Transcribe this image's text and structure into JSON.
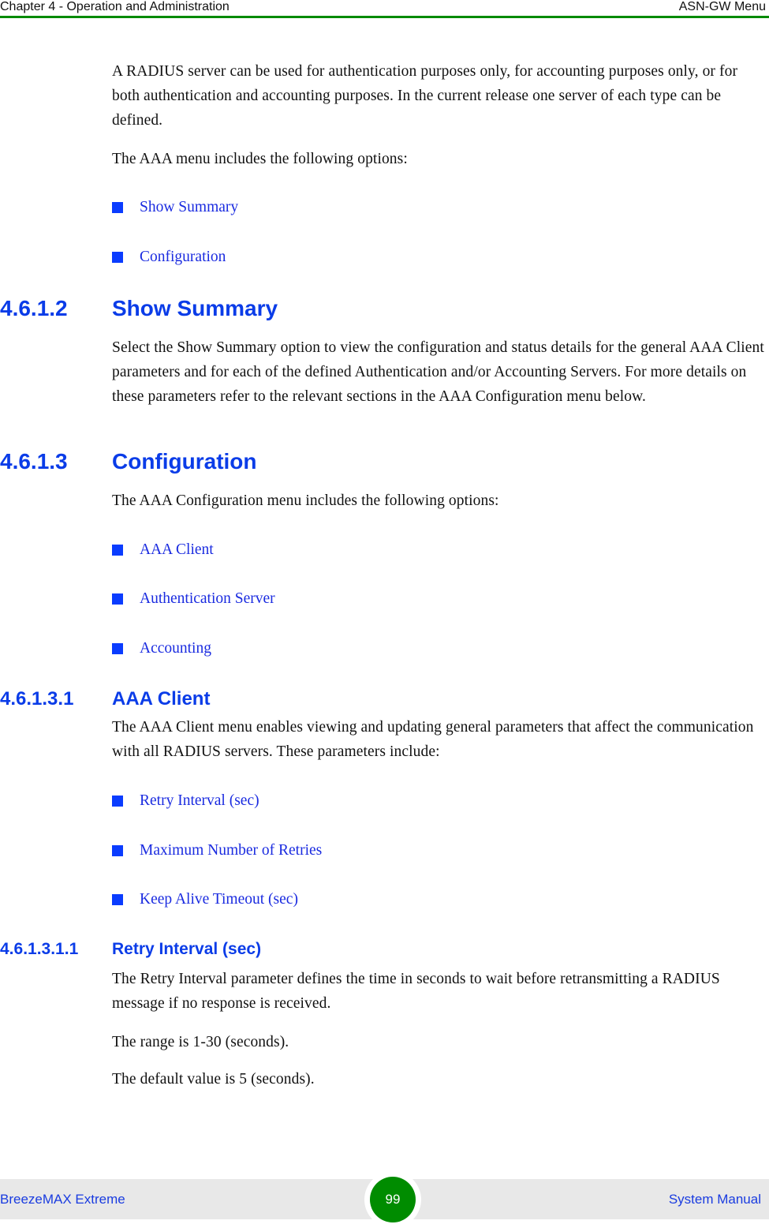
{
  "header": {
    "chapter": "Chapter 4 - Operation and Administration",
    "section": "ASN-GW Menu",
    "rule_color": "#008a00"
  },
  "intro": {
    "paragraph": "A RADIUS server can be used for authentication purposes only, for accounting purposes only, or for both authentication and accounting purposes. In the current release one server of each type can be defined.",
    "lead": "The AAA menu includes the following options:",
    "options": [
      "Show Summary",
      "Configuration"
    ]
  },
  "section_show_summary": {
    "number": "4.6.1.2",
    "title": "Show Summary",
    "paragraph": "Select the Show Summary option to view the configuration and status details for the general AAA Client parameters and for each of the defined Authentication and/or Accounting Servers. For more details on these parameters refer to the relevant sections in the AAA Configuration menu below."
  },
  "section_configuration": {
    "number": "4.6.1.3",
    "title": "Configuration",
    "lead": "The AAA Configuration menu includes the following options:",
    "options": [
      "AAA Client",
      "Authentication Server",
      "Accounting"
    ]
  },
  "section_aaa_client": {
    "number": "4.6.1.3.1",
    "title": "AAA Client",
    "paragraph": "The AAA Client menu enables viewing and updating general parameters that affect the communication with all RADIUS servers. These parameters include:",
    "options": [
      "Retry Interval (sec)",
      "Maximum Number of Retries",
      "Keep Alive Timeout (sec)"
    ]
  },
  "section_retry_interval": {
    "number": "4.6.1.3.1.1",
    "title": "Retry Interval (sec)",
    "paragraph": "The Retry Interval parameter defines the time in seconds to wait before retransmitting a RADIUS message if no response is received.",
    "range": "The range is 1-30 (seconds).",
    "default": "The default value is 5 (seconds)."
  },
  "footer": {
    "product": "BreezeMAX Extreme",
    "page_number": "99",
    "manual": "System Manual",
    "accent_color": "#008c00"
  }
}
